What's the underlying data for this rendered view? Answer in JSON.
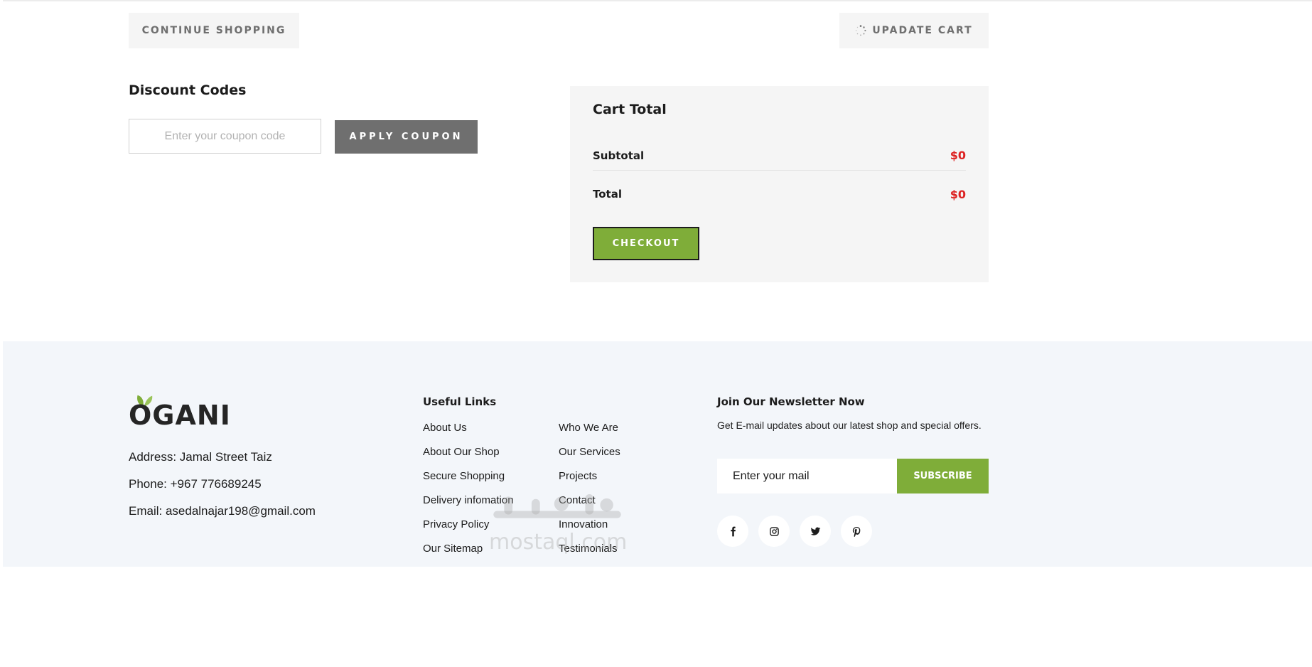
{
  "actions": {
    "continue_label": "CONTINUE SHOPPING",
    "update_label": "UPADATE CART"
  },
  "discount": {
    "title": "Discount Codes",
    "placeholder": "Enter your coupon code",
    "apply_label": "APPLY COUPON"
  },
  "cart": {
    "title": "Cart Total",
    "subtotal_label": "Subtotal",
    "subtotal_value": "$0",
    "total_label": "Total",
    "total_value": "$0",
    "checkout_label": "CHECKOUT"
  },
  "footer": {
    "logo": "OGANI",
    "address": "Address: Jamal Street Taiz",
    "phone": "Phone: +967 776689245",
    "email": "Email: asedalnajar198@gmail.com",
    "links_title": "Useful Links",
    "links_col1": [
      "About Us",
      "About Our Shop",
      "Secure Shopping",
      "Delivery infomation",
      "Privacy Policy",
      "Our Sitemap"
    ],
    "links_col2": [
      "Who We Are",
      "Our Services",
      "Projects",
      "Contact",
      "Innovation",
      "Testimonials"
    ],
    "newsletter_title": "Join Our Newsletter Now",
    "newsletter_text": "Get E-mail updates about our latest shop and special offers.",
    "mail_placeholder": "Enter your mail",
    "subscribe_label": "SUBSCRIBE",
    "social": [
      "facebook-icon",
      "instagram-icon",
      "twitter-icon",
      "pinterest-icon"
    ]
  },
  "watermark": {
    "latin": "mostaql.com"
  },
  "colors": {
    "accent_green": "#7fad39",
    "price_red": "#dd2222",
    "grey_button": "#6f6f6f",
    "footer_bg": "#f3f6fa"
  }
}
